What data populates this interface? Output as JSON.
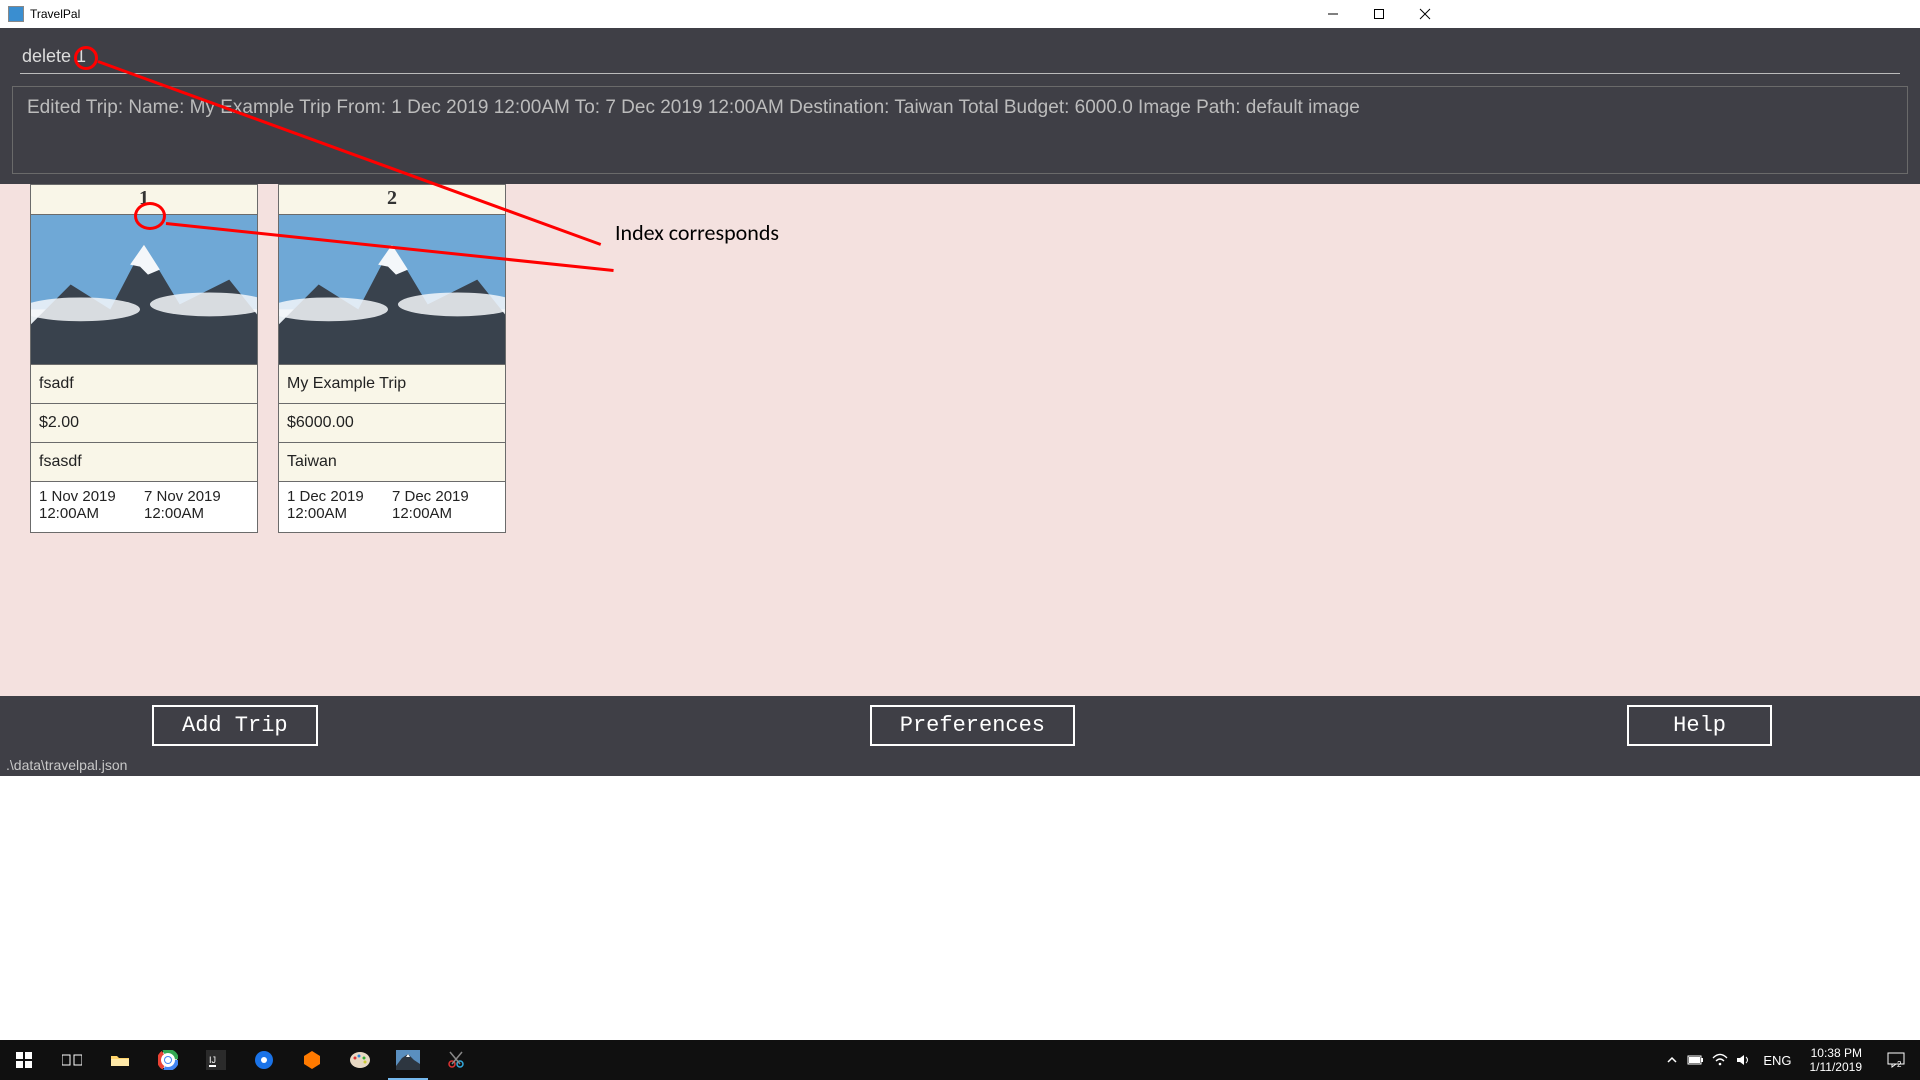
{
  "window": {
    "title": "TravelPal"
  },
  "command": {
    "value": "delete 1"
  },
  "result": {
    "text": "Edited Trip: Name: My Example Trip From: 1 Dec 2019 12:00AM To: 7 Dec 2019 12:00AM Destination: Taiwan Total Budget: 6000.0 Image Path: default image"
  },
  "trips": [
    {
      "index": "1",
      "name": "fsadf",
      "budget": "$2.00",
      "destination": "fsasdf",
      "from_date": "1 Nov 2019",
      "from_time": "12:00AM",
      "to_date": "7 Nov 2019",
      "to_time": "12:00AM"
    },
    {
      "index": "2",
      "name": "My Example Trip",
      "budget": "$6000.00",
      "destination": "Taiwan",
      "from_date": "1 Dec 2019",
      "from_time": "12:00AM",
      "to_date": "7 Dec 2019",
      "to_time": "12:00AM"
    }
  ],
  "annotation": {
    "label": "Index corresponds"
  },
  "footer": {
    "add": "Add Trip",
    "prefs": "Preferences",
    "help": "Help"
  },
  "status": {
    "path": ".\\data\\travelpal.json"
  },
  "taskbar": {
    "lang": "ENG",
    "time": "10:38 PM",
    "date": "1/11/2019",
    "notif_count": "2"
  }
}
